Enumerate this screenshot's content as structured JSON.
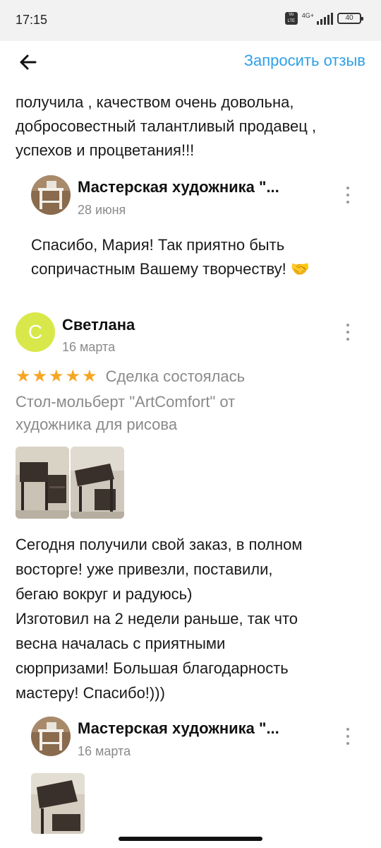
{
  "status_bar": {
    "time": "17:15",
    "volte": "Vo LTE",
    "network": "4G+",
    "battery": "40"
  },
  "top_bar": {
    "back_icon": "arrow-left-icon",
    "request_review": "Запросить отзыв"
  },
  "colors": {
    "link": "#2ea0e6",
    "star": "#f5a623",
    "avatar_letter_bg": "#d8e84a",
    "muted_text": "#8a8a8a"
  },
  "previous_review": {
    "text_lines": [
      "получила , качеством очень довольна,",
      "добросовестный талантливый продавец ,",
      "успехов и процветания!!!"
    ],
    "seller_reply": {
      "name": "Мастерская художника \"...",
      "date": "28 июня",
      "text_lines": [
        "Спасибо, Мария! Так приятно быть",
        "сопричастным Вашему творчеству! 🤝"
      ]
    }
  },
  "review": {
    "avatar_letter": "С",
    "user_name": "Светлана",
    "date": "16 марта",
    "rating": 5,
    "stars": "★★★★★",
    "deal_status": "Сделка состоялась",
    "product_lines": [
      "Стол-мольберт \"ArtComfort\" от",
      "художника для рисова"
    ],
    "photos_count": 2,
    "text_lines": [
      "Сегодня получили свой заказ, в полном",
      "восторге! уже привезли, поставили,",
      "бегаю вокруг и радуюсь)",
      "Изготовил на 2 недели раньше, так что",
      "весна началась с приятными",
      "сюрпризами! Большая благодарность",
      "мастеру! Спасибо!)))"
    ],
    "seller_reply": {
      "name": "Мастерская художника \"...",
      "date": "16 марта",
      "photos_count": 1
    }
  }
}
